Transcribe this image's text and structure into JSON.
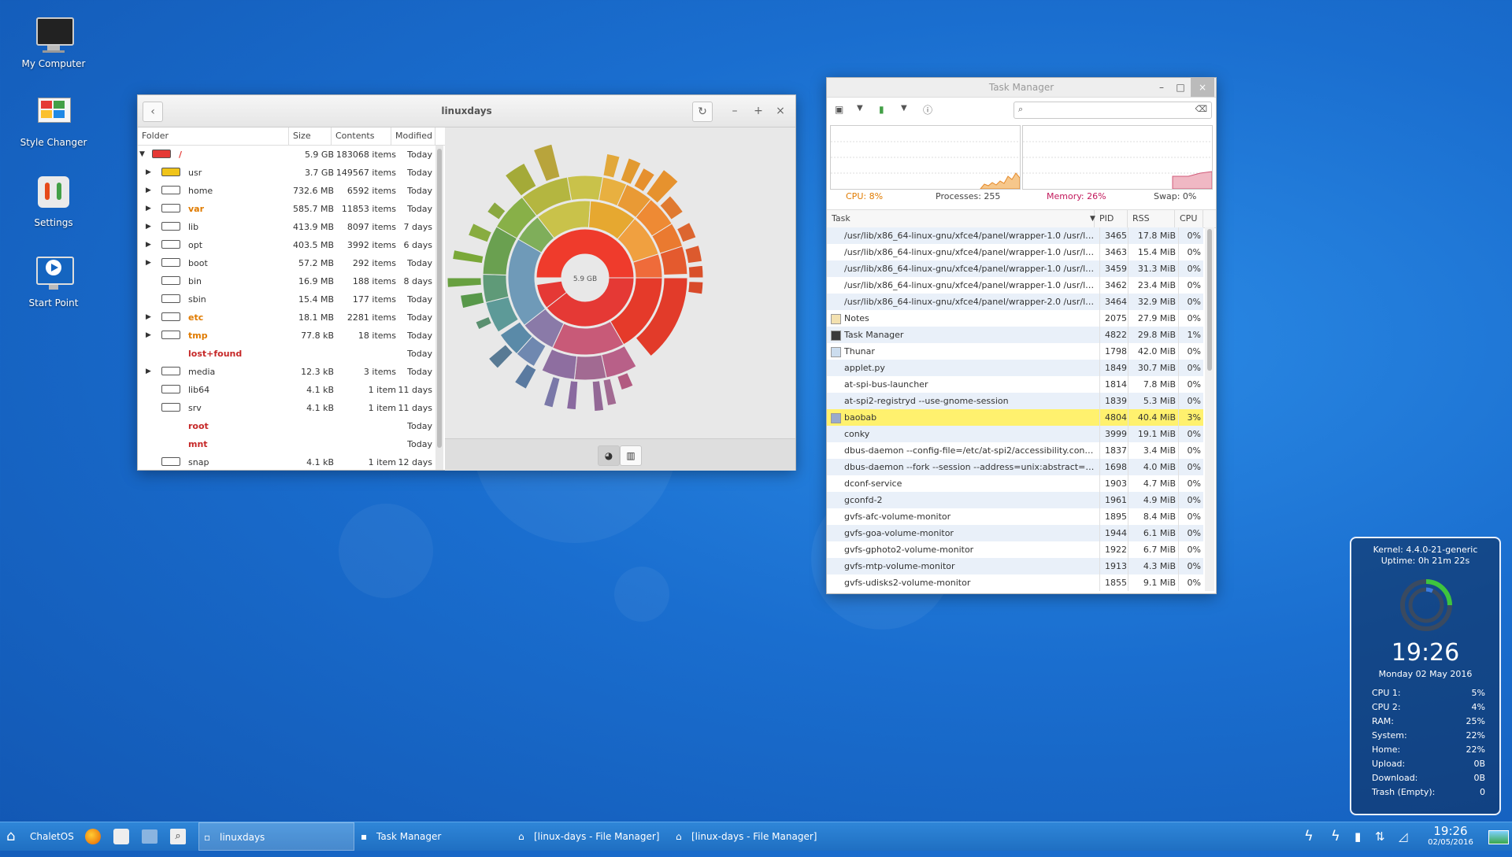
{
  "desktop": {
    "icons": [
      {
        "label": "My Computer"
      },
      {
        "label": "Style Changer"
      },
      {
        "label": "Settings"
      },
      {
        "label": "Start Point"
      }
    ]
  },
  "baobab": {
    "title": "linuxdays",
    "columns": {
      "folder": "Folder",
      "size": "Size",
      "contents": "Contents",
      "modified": "Modified"
    },
    "rows": [
      {
        "name": "/",
        "size": "5.9 GB",
        "contents": "183068 items",
        "modified": "Today"
      },
      {
        "name": "usr",
        "size": "3.7 GB",
        "contents": "149567 items",
        "modified": "Today"
      },
      {
        "name": "home",
        "size": "732.6 MB",
        "contents": "6592 items",
        "modified": "Today"
      },
      {
        "name": "var",
        "size": "585.7 MB",
        "contents": "11853 items",
        "modified": "Today"
      },
      {
        "name": "lib",
        "size": "413.9 MB",
        "contents": "8097 items",
        "modified": "7 days"
      },
      {
        "name": "opt",
        "size": "403.5 MB",
        "contents": "3992 items",
        "modified": "6 days"
      },
      {
        "name": "boot",
        "size": "57.2 MB",
        "contents": "292 items",
        "modified": "Today"
      },
      {
        "name": "bin",
        "size": "16.9 MB",
        "contents": "188 items",
        "modified": "8 days"
      },
      {
        "name": "sbin",
        "size": "15.4 MB",
        "contents": "177 items",
        "modified": "Today"
      },
      {
        "name": "etc",
        "size": "18.1 MB",
        "contents": "2281 items",
        "modified": "Today"
      },
      {
        "name": "tmp",
        "size": "77.8 kB",
        "contents": "18 items",
        "modified": "Today"
      },
      {
        "name": "lost+found",
        "size": "",
        "contents": "",
        "modified": "Today"
      },
      {
        "name": "media",
        "size": "12.3 kB",
        "contents": "3 items",
        "modified": "Today"
      },
      {
        "name": "lib64",
        "size": "4.1 kB",
        "contents": "1 item",
        "modified": "11 days"
      },
      {
        "name": "srv",
        "size": "4.1 kB",
        "contents": "1 item",
        "modified": "11 days"
      },
      {
        "name": "root",
        "size": "",
        "contents": "",
        "modified": "Today"
      },
      {
        "name": "mnt",
        "size": "",
        "contents": "",
        "modified": "Today"
      },
      {
        "name": "snap",
        "size": "4.1 kB",
        "contents": "1 item",
        "modified": "12 days"
      }
    ],
    "chart_center_label": "5.9 GB"
  },
  "taskmanager": {
    "title": "Task Manager",
    "cpu": "CPU: 8%",
    "processes": "Processes: 255",
    "memory": "Memory: 26%",
    "swap": "Swap: 0%",
    "columns": {
      "task": "Task",
      "pid": "PID",
      "rss": "RSS",
      "cpu": "CPU"
    },
    "rows": [
      {
        "task": "/usr/lib/x86_64-linux-gnu/xfce4/panel/wrapper-1.0 /usr/lib/x...",
        "pid": "3465",
        "rss": "17.8 MiB",
        "cpu": "0%"
      },
      {
        "task": "/usr/lib/x86_64-linux-gnu/xfce4/panel/wrapper-1.0 /usr/lib/x...",
        "pid": "3463",
        "rss": "15.4 MiB",
        "cpu": "0%"
      },
      {
        "task": "/usr/lib/x86_64-linux-gnu/xfce4/panel/wrapper-1.0 /usr/lib/x...",
        "pid": "3459",
        "rss": "31.3 MiB",
        "cpu": "0%"
      },
      {
        "task": "/usr/lib/x86_64-linux-gnu/xfce4/panel/wrapper-1.0 /usr/lib/x...",
        "pid": "3462",
        "rss": "23.4 MiB",
        "cpu": "0%"
      },
      {
        "task": "/usr/lib/x86_64-linux-gnu/xfce4/panel/wrapper-2.0 /usr/lib/x...",
        "pid": "3464",
        "rss": "32.9 MiB",
        "cpu": "0%"
      },
      {
        "task": "Notes",
        "pid": "2075",
        "rss": "27.9 MiB",
        "cpu": "0%"
      },
      {
        "task": "Task Manager",
        "pid": "4822",
        "rss": "29.8 MiB",
        "cpu": "1%"
      },
      {
        "task": "Thunar",
        "pid": "1798",
        "rss": "42.0 MiB",
        "cpu": "0%"
      },
      {
        "task": "applet.py",
        "pid": "1849",
        "rss": "30.7 MiB",
        "cpu": "0%"
      },
      {
        "task": "at-spi-bus-launcher",
        "pid": "1814",
        "rss": "7.8 MiB",
        "cpu": "0%"
      },
      {
        "task": "at-spi2-registryd --use-gnome-session",
        "pid": "1839",
        "rss": "5.3 MiB",
        "cpu": "0%"
      },
      {
        "task": "baobab",
        "pid": "4804",
        "rss": "40.4 MiB",
        "cpu": "3%"
      },
      {
        "task": "conky",
        "pid": "3999",
        "rss": "19.1 MiB",
        "cpu": "0%"
      },
      {
        "task": "dbus-daemon --config-file=/etc/at-spi2/accessibility.conf --no...",
        "pid": "1837",
        "rss": "3.4 MiB",
        "cpu": "0%"
      },
      {
        "task": "dbus-daemon --fork --session --address=unix:abstract=/tmp/...",
        "pid": "1698",
        "rss": "4.0 MiB",
        "cpu": "0%"
      },
      {
        "task": "dconf-service",
        "pid": "1903",
        "rss": "4.7 MiB",
        "cpu": "0%"
      },
      {
        "task": "gconfd-2",
        "pid": "1961",
        "rss": "4.9 MiB",
        "cpu": "0%"
      },
      {
        "task": "gvfs-afc-volume-monitor",
        "pid": "1895",
        "rss": "8.4 MiB",
        "cpu": "0%"
      },
      {
        "task": "gvfs-goa-volume-monitor",
        "pid": "1944",
        "rss": "6.1 MiB",
        "cpu": "0%"
      },
      {
        "task": "gvfs-gphoto2-volume-monitor",
        "pid": "1922",
        "rss": "6.7 MiB",
        "cpu": "0%"
      },
      {
        "task": "gvfs-mtp-volume-monitor",
        "pid": "1913",
        "rss": "4.3 MiB",
        "cpu": "0%"
      },
      {
        "task": "gvfs-udisks2-volume-monitor",
        "pid": "1855",
        "rss": "9.1 MiB",
        "cpu": "0%"
      }
    ]
  },
  "conky": {
    "kernel": "Kernel: 4.4.0-21-generic",
    "uptime": "Uptime: 0h 21m 22s",
    "time": "19:26",
    "date": "Monday 02 May 2016",
    "stats": [
      {
        "label": "CPU 1:",
        "value": "5%"
      },
      {
        "label": "CPU 2:",
        "value": "4%"
      },
      {
        "label": "RAM:",
        "value": "25%"
      },
      {
        "label": "System:",
        "value": "22%"
      },
      {
        "label": "Home:",
        "value": "22%"
      },
      {
        "label": "Upload:",
        "value": "0B"
      },
      {
        "label": "Download:",
        "value": "0B"
      },
      {
        "label": "Trash (Empty):",
        "value": "0"
      }
    ]
  },
  "taskbar": {
    "menu_label": "ChaletOS",
    "tasks": [
      {
        "label": "linuxdays"
      },
      {
        "label": "Task Manager"
      },
      {
        "label": "[linux-days - File Manager]"
      },
      {
        "label": "[linux-days - File Manager]"
      }
    ],
    "clock_time": "19:26",
    "clock_date": "02/05/2016"
  }
}
